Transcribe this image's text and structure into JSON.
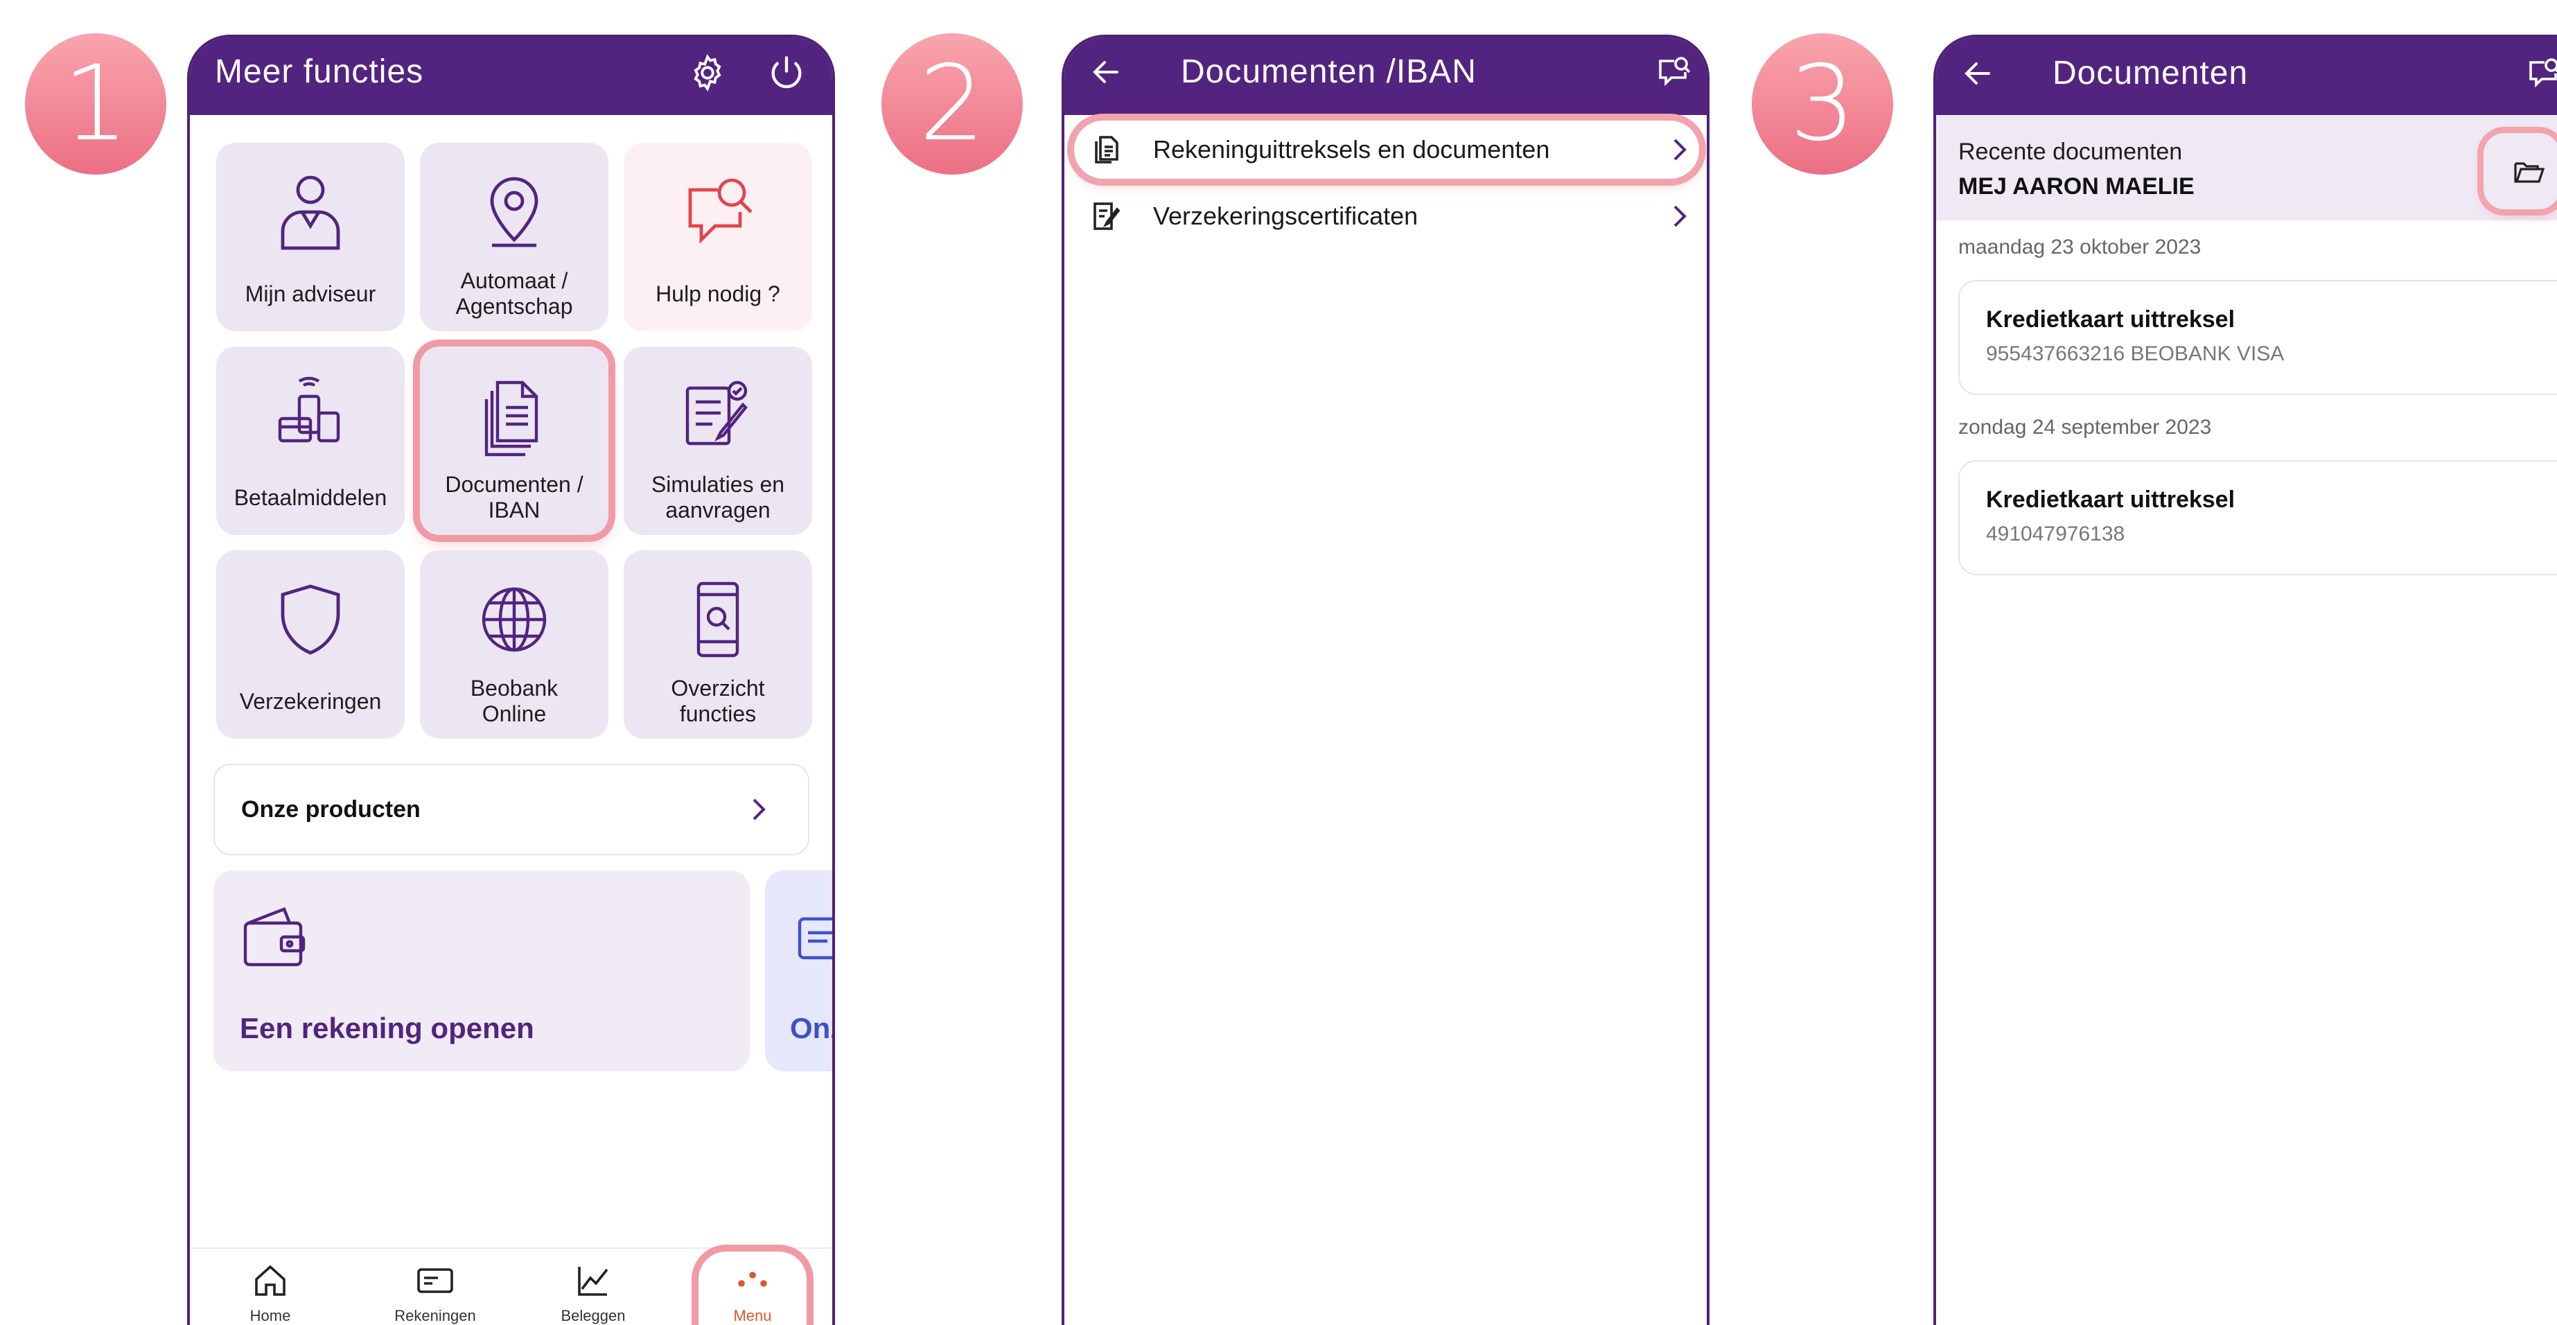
{
  "steps": [
    "1",
    "2",
    "3"
  ],
  "colors": {
    "header": "#52247f",
    "step_circle": "#ec6f84",
    "highlight_ring": "#f09aa5",
    "tile_bg": "#ece6f2",
    "active_nav": "#d95a2a"
  },
  "screen1": {
    "title": "Meer functies",
    "header_icons": [
      "settings-icon",
      "power-icon"
    ],
    "tiles": [
      {
        "label": "Mijn adviseur",
        "icon": "person-icon"
      },
      {
        "label": "Automaat /\nAgentschap",
        "icon": "location-pin-icon"
      },
      {
        "label": "Hulp nodig ?",
        "icon": "help-chat-search-icon"
      },
      {
        "label": "Betaalmiddelen",
        "icon": "payment-devices-icon"
      },
      {
        "label": "Documenten /\nIBAN",
        "icon": "documents-icon",
        "highlighted": true
      },
      {
        "label": "Simulaties en\naanvragen",
        "icon": "simulation-form-icon"
      },
      {
        "label": "Verzekeringen",
        "icon": "shield-icon"
      },
      {
        "label": "Beobank\nOnline",
        "icon": "globe-icon"
      },
      {
        "label": "Overzicht\nfuncties",
        "icon": "phone-search-icon"
      }
    ],
    "products_label": "Onze producten",
    "cards": [
      {
        "label": "Een rekening openen",
        "icon": "wallet-icon"
      },
      {
        "label": "Onz",
        "icon": "card-icon"
      }
    ],
    "nav": [
      {
        "label": "Home",
        "icon": "home-icon"
      },
      {
        "label": "Rekeningen",
        "icon": "account-card-icon"
      },
      {
        "label": "Beleggen",
        "icon": "chart-line-icon"
      },
      {
        "label": "Menu",
        "icon": "menu-dots-icon",
        "active": true
      }
    ]
  },
  "screen2": {
    "title": "Documenten /IBAN",
    "items": [
      {
        "label": "Rekeninguittreksels en documenten",
        "icon": "statements-icon",
        "highlighted": true
      },
      {
        "label": "Verzekeringscertificaten",
        "icon": "certificate-icon"
      }
    ]
  },
  "screen3": {
    "title": "Documenten",
    "recent_label": "Recente documenten",
    "account_holder": "MEJ AARON MAELIE",
    "groups": [
      {
        "date": "maandag 23 oktober 2023",
        "doc_title": "Kredietkaart uittreksel",
        "doc_sub": "955437663216 BEOBANK VISA"
      },
      {
        "date": "zondag 24 september 2023",
        "doc_title": "Kredietkaart uittreksel",
        "doc_sub": "491047976138"
      }
    ]
  }
}
